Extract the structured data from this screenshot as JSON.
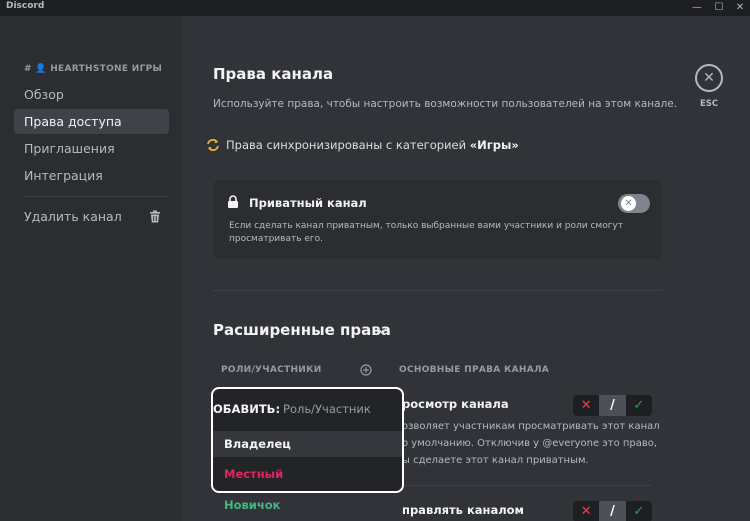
{
  "app": {
    "title": "Discord"
  },
  "window_controls": {
    "minimize": "—",
    "maximize": "☐",
    "close": "✕"
  },
  "sidebar": {
    "header": "# 👤 HEARTHSTONE ИГРЫ",
    "items": [
      {
        "label": "Обзор",
        "active": false
      },
      {
        "label": "Права доступа",
        "active": true
      },
      {
        "label": "Приглашения",
        "active": false
      },
      {
        "label": "Интеграция",
        "active": false
      }
    ],
    "delete_label": "Удалить канал"
  },
  "main": {
    "title": "Права канала",
    "description": "Используйте права, чтобы настроить возможности пользователей на этом канале.",
    "sync": {
      "text": "Права синхронизированы с категорией ",
      "category": "«Игры»"
    },
    "private_channel": {
      "title": "Приватный канал",
      "description": "Если сделать канал приватным, только выбранные вами участники и роли смогут просматривать его.",
      "enabled": false
    },
    "advanced": {
      "title": "Расширенные права",
      "roles_header": "РОЛИ/УЧАСТНИКИ",
      "perms_header": "ОСНОВНЫЕ ПРАВА КАНАЛА",
      "roles": [
        {
          "label": "Новичок",
          "color": "#43b581"
        }
      ],
      "permissions": [
        {
          "title": "росмотр канала",
          "description": [
            "озволяет участникам просматривать этот канал",
            "о умолчанию. Отключив у @everyone это право,",
            "ы сделаете этот канал приватным."
          ],
          "state": "neutral"
        },
        {
          "title": "правлять каналом",
          "description": [],
          "state": "neutral"
        }
      ],
      "tri_state": {
        "deny": "✕",
        "neutral": "/",
        "allow": "✓"
      }
    }
  },
  "dropdown": {
    "prefix": "ОБАВИТЬ:",
    "placeholder": "Роль/Участник",
    "items": [
      {
        "label": "Владелец",
        "color": "#f2f3f5",
        "highlighted": true
      },
      {
        "label": "Местный",
        "color": "#e0245e",
        "highlighted": false
      }
    ]
  },
  "close": {
    "label": "ESC"
  },
  "colors": {
    "accent_deny": "#f23f43",
    "accent_allow": "#23a559",
    "background": "#313338",
    "sidebar": "#2b2d31"
  }
}
